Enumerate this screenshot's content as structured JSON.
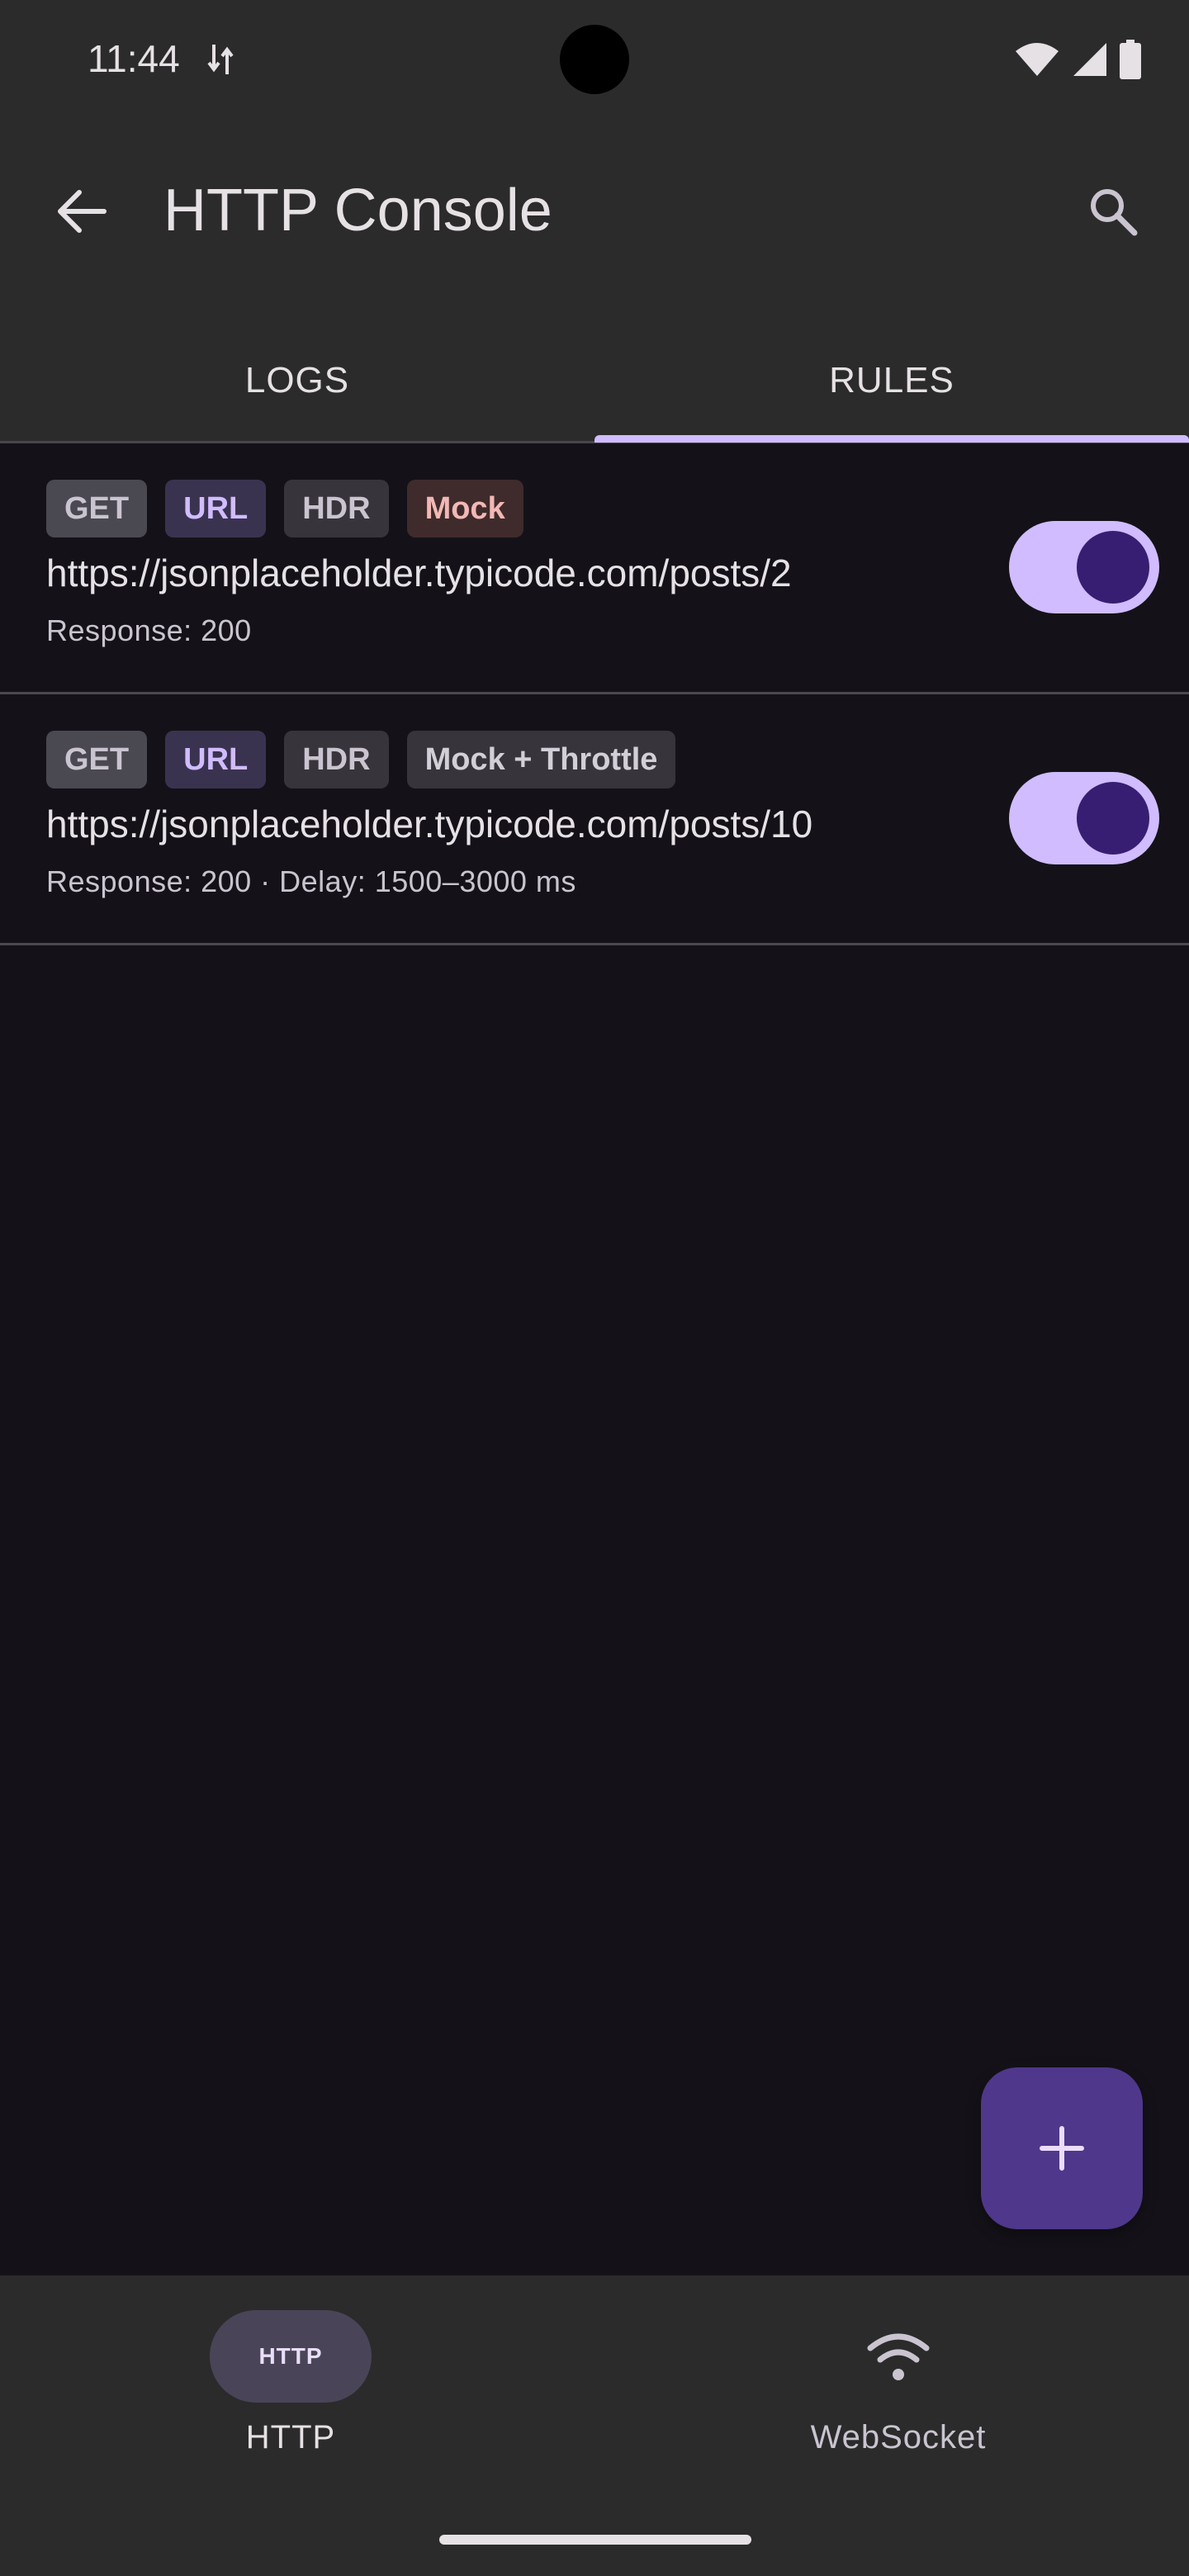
{
  "status_bar": {
    "time": "11:44",
    "icons": [
      "data-transfer-icon",
      "wifi-icon",
      "signal-icon",
      "battery-icon"
    ]
  },
  "app_bar": {
    "title": "HTTP Console",
    "back_icon": "arrow-back-icon",
    "search_icon": "search-icon"
  },
  "tabs": [
    {
      "label": "LOGS",
      "selected": false
    },
    {
      "label": "RULES",
      "selected": true
    }
  ],
  "rules": [
    {
      "chips": [
        "GET",
        "URL",
        "HDR",
        "Mock"
      ],
      "url": "https://jsonplaceholder.typicode.com/posts/2",
      "meta": "Response: 200",
      "enabled": true
    },
    {
      "chips": [
        "GET",
        "URL",
        "HDR",
        "Mock + Throttle"
      ],
      "url": "https://jsonplaceholder.typicode.com/posts/10",
      "meta": "Response: 200 · Delay: 1500–3000 ms",
      "enabled": true
    }
  ],
  "fab": {
    "icon": "plus-icon"
  },
  "bottom_nav": [
    {
      "label": "HTTP",
      "badge": "HTTP",
      "selected": true
    },
    {
      "label": "WebSocket",
      "icon": "wifi-icon",
      "selected": false
    }
  ],
  "colors": {
    "accent": "#d0bcff",
    "surface": "#2b2b2b",
    "background": "#141218",
    "fab": "#4f378b",
    "mock_chip_text": "#f2b8b5"
  }
}
